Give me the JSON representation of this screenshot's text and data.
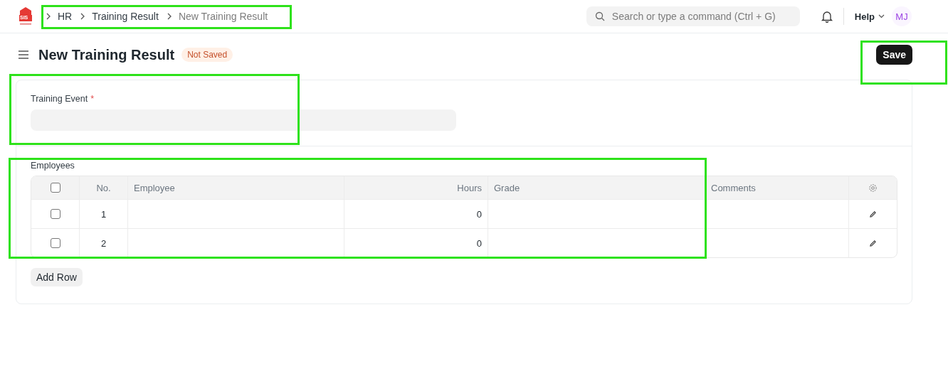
{
  "logo": {
    "text": "SIS"
  },
  "breadcrumbs": [
    "HR",
    "Training Result",
    "New Training Result"
  ],
  "search": {
    "placeholder": "Search or type a command (Ctrl + G)"
  },
  "help": {
    "label": "Help"
  },
  "avatar": {
    "initials": "MJ"
  },
  "page": {
    "title": "New Training Result",
    "status": "Not Saved",
    "save": "Save"
  },
  "field": {
    "label": "Training Event",
    "required": true,
    "required_mark": "*"
  },
  "table": {
    "label": "Employees",
    "columns": [
      "No.",
      "Employee",
      "Hours",
      "Grade",
      "Comments"
    ],
    "header_checked": false,
    "rows": [
      {
        "no": "1",
        "hours": "0",
        "checked": false
      },
      {
        "no": "2",
        "hours": "0",
        "checked": false
      }
    ],
    "add_row": "Add Row"
  },
  "highlights": [
    {
      "kind": "breadcrumbs"
    },
    {
      "kind": "save"
    },
    {
      "kind": "field"
    },
    {
      "kind": "table"
    }
  ]
}
